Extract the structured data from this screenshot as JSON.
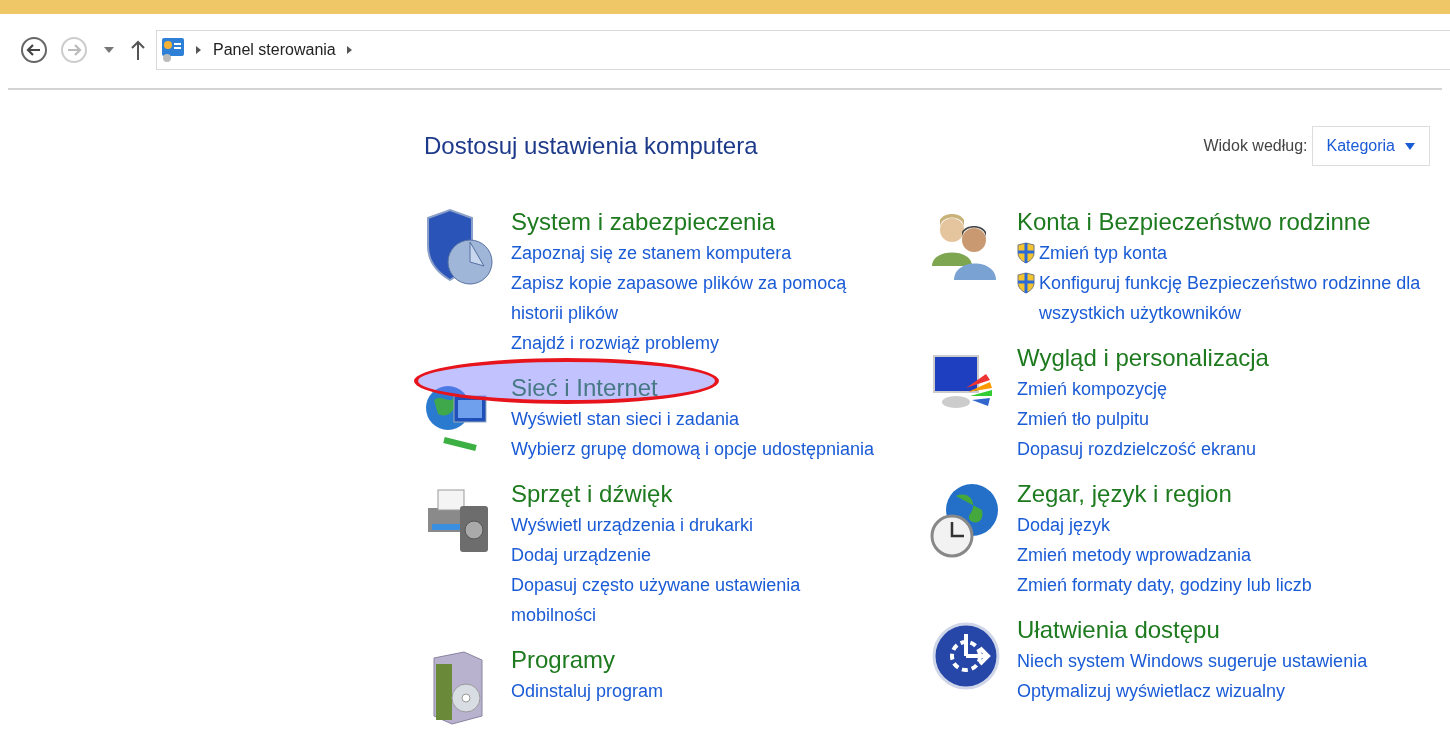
{
  "address_bar": {
    "path": [
      "Panel sterowania"
    ]
  },
  "heading": "Dostosuj ustawienia komputera",
  "view_by": {
    "label": "Widok według:",
    "value": "Kategoria"
  },
  "columns": [
    {
      "categories": [
        {
          "kind": "security",
          "title": "System i zabezpieczenia",
          "highlighted": false,
          "links": [
            {
              "text": "Zapoznaj się ze stanem komputera",
              "shield": false
            },
            {
              "text": "Zapisz kopie zapasowe plików za pomocą historii plików",
              "shield": false
            },
            {
              "text": "Znajdź i rozwiąż problemy",
              "shield": false
            }
          ]
        },
        {
          "kind": "network",
          "title": "Sieć i Internet",
          "highlighted": true,
          "links": [
            {
              "text": "Wyświetl stan sieci i zadania",
              "shield": false
            },
            {
              "text": "Wybierz grupę domową i opcje udostępniania",
              "shield": false
            }
          ]
        },
        {
          "kind": "hardware",
          "title": "Sprzęt i dźwięk",
          "highlighted": false,
          "links": [
            {
              "text": "Wyświetl urządzenia i drukarki",
              "shield": false
            },
            {
              "text": "Dodaj urządzenie",
              "shield": false
            },
            {
              "text": "Dopasuj często używane ustawienia mobilności",
              "shield": false
            }
          ]
        },
        {
          "kind": "programs",
          "title": "Programy",
          "highlighted": false,
          "links": [
            {
              "text": "Odinstaluj program",
              "shield": false
            }
          ]
        }
      ]
    },
    {
      "categories": [
        {
          "kind": "accounts",
          "title": "Konta i Bezpieczeństwo rodzinne",
          "highlighted": false,
          "links": [
            {
              "text": "Zmień typ konta",
              "shield": true
            },
            {
              "text": "Konfiguruj funkcję Bezpieczeństwo rodzinne dla wszystkich użytkowników",
              "shield": true
            }
          ]
        },
        {
          "kind": "appearance",
          "title": "Wygląd i personalizacja",
          "highlighted": false,
          "links": [
            {
              "text": "Zmień kompozycję",
              "shield": false
            },
            {
              "text": "Zmień tło pulpitu",
              "shield": false
            },
            {
              "text": "Dopasuj rozdzielczość ekranu",
              "shield": false
            }
          ]
        },
        {
          "kind": "clock",
          "title": "Zegar, język i region",
          "highlighted": false,
          "links": [
            {
              "text": "Dodaj język",
              "shield": false
            },
            {
              "text": "Zmień metody wprowadzania",
              "shield": false
            },
            {
              "text": "Zmień formaty daty, godziny lub liczb",
              "shield": false
            }
          ]
        },
        {
          "kind": "access",
          "title": "Ułatwienia dostępu",
          "highlighted": false,
          "links": [
            {
              "text": "Niech system Windows sugeruje ustawienia",
              "shield": false
            },
            {
              "text": "Optymalizuj wyświetlacz wizualny",
              "shield": false
            }
          ]
        }
      ]
    }
  ]
}
